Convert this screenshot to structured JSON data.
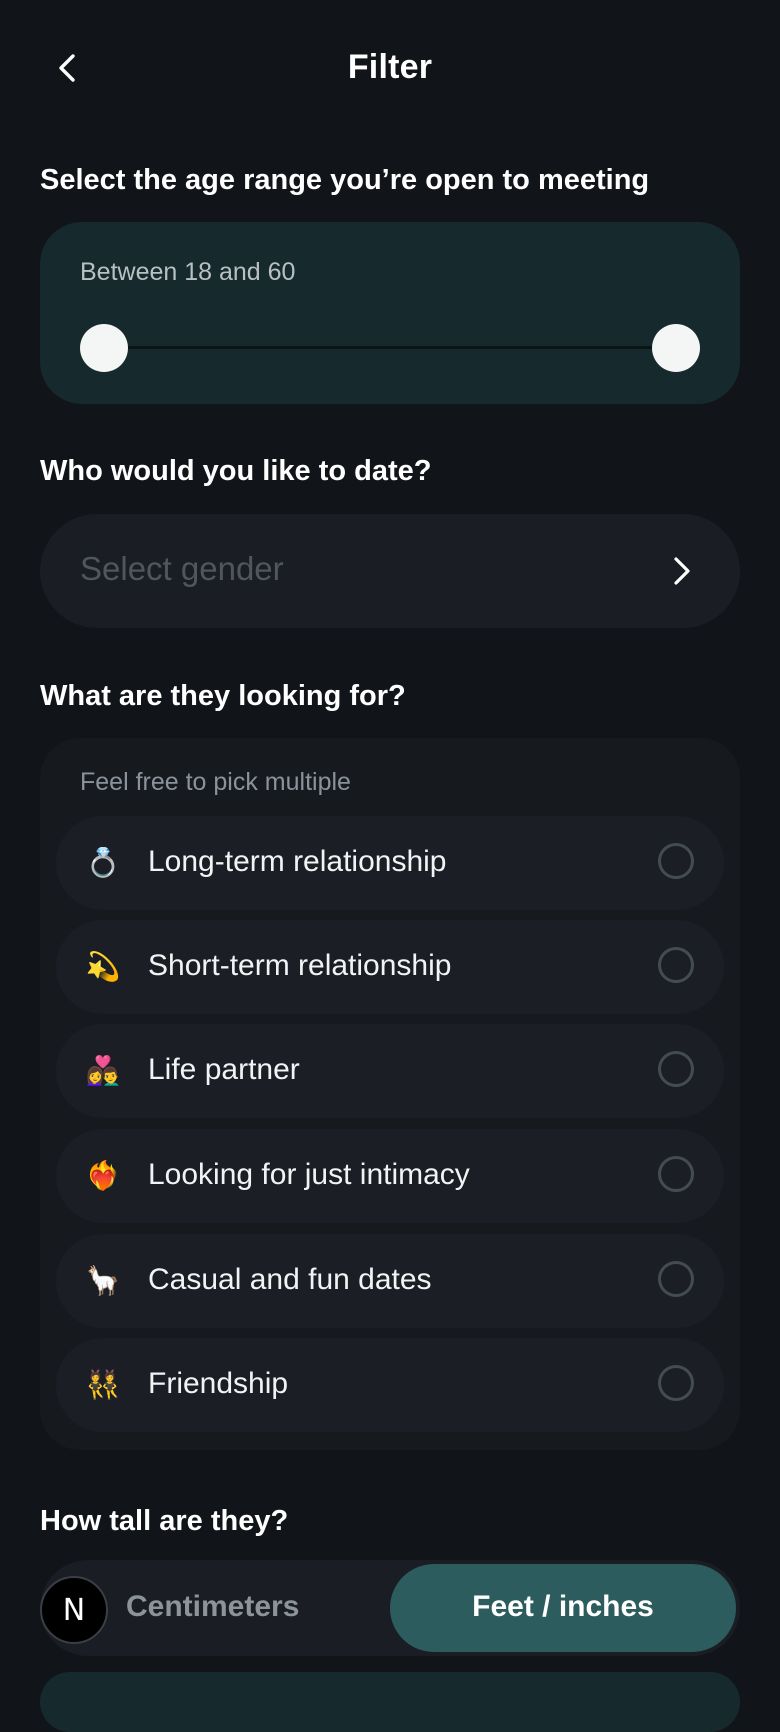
{
  "header": {
    "title": "Filter",
    "back_icon": "chevron-left-icon"
  },
  "age": {
    "section_title": "Select the age range you’re open to meeting",
    "range_label": "Between 18 and 60",
    "min": 18,
    "max": 60
  },
  "gender": {
    "section_title": "Who would you like to date?",
    "placeholder": "Select gender",
    "chevron_icon": "chevron-right-icon"
  },
  "looking": {
    "section_title": "What are they looking for?",
    "hint": "Feel free to pick multiple",
    "options": [
      {
        "emoji": "💍",
        "icon": "ring-icon",
        "label": "Long-term relationship",
        "selected": false
      },
      {
        "emoji": "💫",
        "icon": "dizzy-star-icon",
        "label": "Short-term relationship",
        "selected": false
      },
      {
        "emoji": "👩‍❤️‍👨",
        "icon": "couple-heart-icon",
        "label": "Life partner",
        "selected": false
      },
      {
        "emoji": "❤️‍🔥",
        "icon": "heart-on-fire-icon",
        "label": "Looking for just intimacy",
        "selected": false
      },
      {
        "emoji": "🦙",
        "icon": "llama-icon",
        "label": "Casual and fun dates",
        "selected": false
      },
      {
        "emoji": "👯",
        "icon": "people-dancing-icon",
        "label": "Friendship",
        "selected": false
      }
    ]
  },
  "height": {
    "section_title": "How tall are they?",
    "unit_cm_label": "Centimeters",
    "unit_ft_label": "Feet / inches",
    "selected_unit": "Feet / inches",
    "badge_letter": "N"
  },
  "colors": {
    "background": "#111418",
    "accent_card": "#16292d",
    "accent_selected": "#2d5c5e"
  }
}
